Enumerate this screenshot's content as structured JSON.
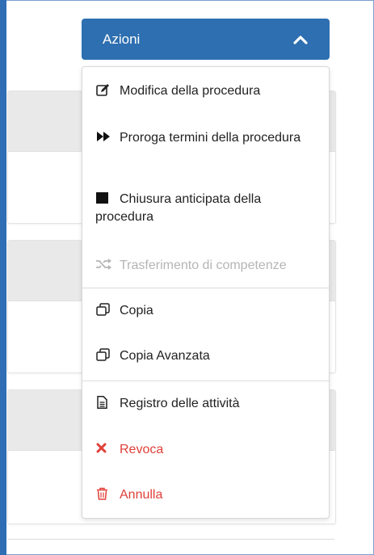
{
  "actions": {
    "label": "Azioni",
    "menu": {
      "edit": "Modifica della procedura",
      "extend": "Proroga termini della procedura",
      "close_early": "Chiusura anticipata della procedura",
      "transfer": "Trasferimento di competenze",
      "copy": "Copia",
      "copy_advanced": "Copia Avanzata",
      "activity_log": "Registro delle attività",
      "revoke": "Revoca",
      "cancel": "Annulla"
    }
  },
  "colors": {
    "primary": "#2d6fb0",
    "danger": "#e0403a",
    "disabled": "#b5b5b5"
  },
  "icons": {
    "edit": "pencil-square-icon",
    "extend": "fast-forward-icon",
    "close_early": "stop-square-icon",
    "transfer": "shuffle-icon",
    "copy": "copy-icon",
    "copy_advanced": "copy-icon",
    "activity_log": "document-icon",
    "revoke": "x-icon",
    "cancel": "trash-icon"
  }
}
